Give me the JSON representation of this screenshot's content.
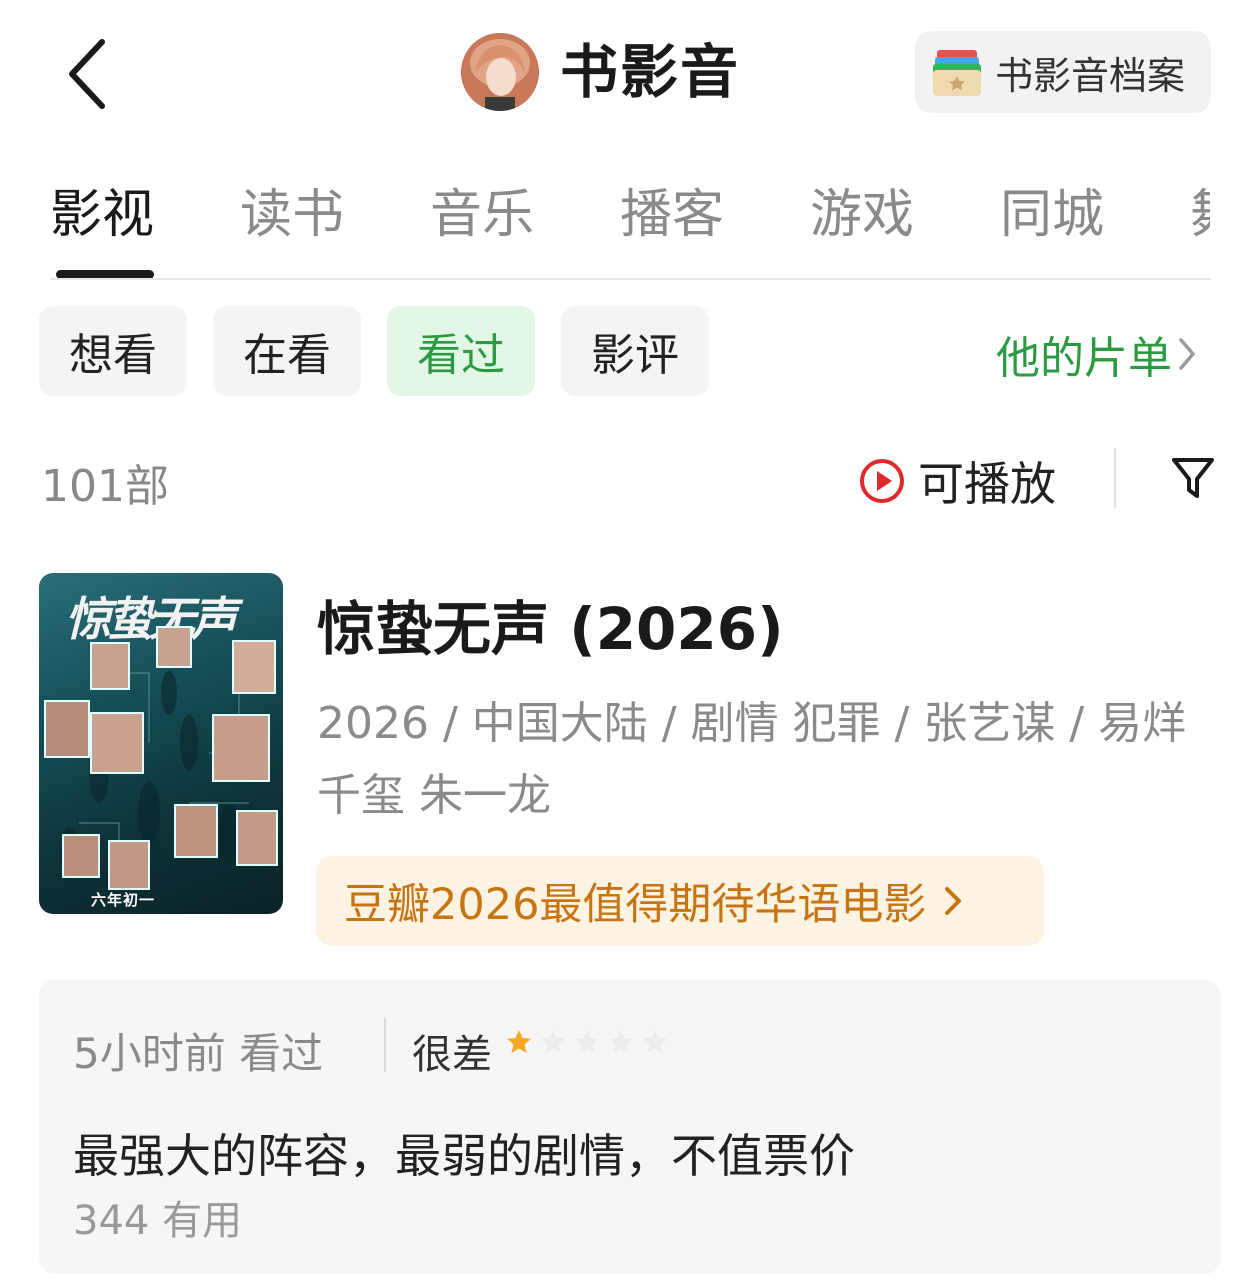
{
  "header": {
    "title": "书影音",
    "archive_label": "书影音档案"
  },
  "tabs": [
    "影视",
    "读书",
    "音乐",
    "播客",
    "游戏",
    "同城",
    "舞"
  ],
  "active_tab": 0,
  "filters": [
    "想看",
    "在看",
    "看过",
    "影评"
  ],
  "active_filter": 2,
  "his_list_label": "他的片单",
  "count_label": "101部",
  "playable_label": "可播放",
  "movie": {
    "title": "惊蛰无声 (2026)",
    "meta": "2026 / 中国大陆 / 剧情 犯罪 / 张艺谋 / 易烊千玺 朱一龙",
    "rank_banner": "豆瓣2026最值得期待华语电影",
    "poster_title": "惊蛰无声",
    "poster_caption": "六年初一"
  },
  "review": {
    "time": "5小时前 看过",
    "rating_label": "很差",
    "stars_filled": 1,
    "stars_total": 5,
    "text": "最强大的阵容，最弱的剧情，不值票价",
    "useful": "344 有用"
  },
  "colors": {
    "accent_green": "#2b9a41",
    "banner_orange": "#c77512",
    "star": "#f5a623",
    "play_red": "#e0292b"
  }
}
